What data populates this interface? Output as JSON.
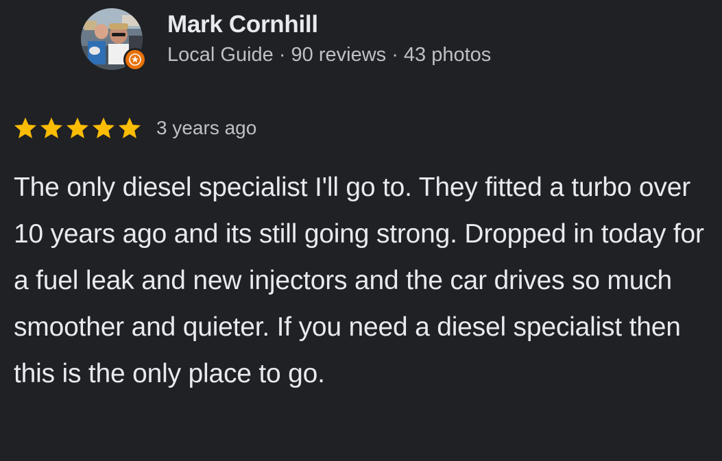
{
  "review": {
    "reviewer": {
      "name": "Mark Cornhill",
      "meta": "Local Guide · 90 reviews · 43 photos",
      "avatar_icon": "avatar-photo",
      "badge_icon": "local-guide-star-icon",
      "badge_color": "#e8710a"
    },
    "rating": {
      "stars": 5,
      "max_stars": 5,
      "star_color": "#fbbc04",
      "time_ago": "3 years ago"
    },
    "text": "The only diesel specialist I'll go to. They fitted a turbo over 10 years ago and its still going strong. Dropped in today for a fuel leak and new injectors and the car drives so much smoother and quieter. If you need a diesel specialist then this is the only place to go."
  },
  "colors": {
    "background": "#202124",
    "primary_text": "#e8eaed",
    "secondary_text": "#bdc1c6"
  }
}
